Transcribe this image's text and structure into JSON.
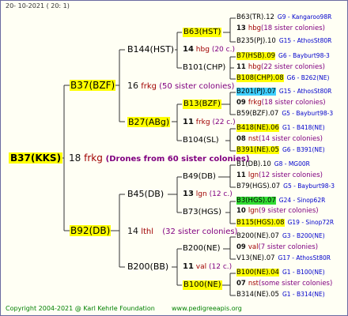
{
  "header": "20- 10-2021 ( 20: 1)",
  "footer": {
    "copyright": "Copyright 2004-2021 @ Karl Kehrle Foundation",
    "url": "www.pedigreeapis.org"
  },
  "root": {
    "name": "B37(KKS)",
    "num": "18",
    "code": "frkg",
    "note": "(Drones from 60 sister colonies)"
  },
  "gen1": [
    {
      "name": "B37(BZF)",
      "num": "16",
      "code": "frkg",
      "note": "(50 sister colonies)"
    },
    {
      "name": "B92(DB)",
      "num": "14",
      "code": "lthl",
      "note": "(32 sister colonies)"
    }
  ],
  "gen2": [
    {
      "name": "B144(HST)",
      "num": "14",
      "code": "hbg",
      "note": "(20 c.)"
    },
    {
      "name": "B27(ABg)",
      "num": "11",
      "code": "frkg",
      "note": "(22 c.)"
    },
    {
      "name": "B45(DB)",
      "num": "13",
      "code": "lgn",
      "note": "(12 c.)"
    },
    {
      "name": "B200(BB)",
      "num": "11",
      "code": "val",
      "note": "(12 c.)"
    }
  ],
  "gen3": [
    {
      "name": "B63(HST)",
      "num": "14",
      "code": "hbg",
      "note": "(20 c.)"
    },
    {
      "name": "B101(CHP)",
      "num": "11",
      "code": "hbg",
      "note": "(22 c.)"
    },
    {
      "name": "B13(BZF)",
      "num": "11",
      "code": "frkg",
      "note": "(22 c.)"
    },
    {
      "name": "B104(SL)",
      "num": "08",
      "code": "nst",
      "note": "(12 c.)"
    },
    {
      "name": "B49(DB)",
      "num": "11",
      "code": "lgn",
      "note": "(12 c.)"
    },
    {
      "name": "B73(HGS)",
      "num": "10",
      "code": "lgn",
      "note": "(12 c.)"
    },
    {
      "name": "B200(NE)",
      "num": "11",
      "code": "val",
      "note": "(12 c.)"
    },
    {
      "name": "B100(NE)",
      "num": "",
      "code": "",
      "note": ""
    }
  ],
  "gen4": [
    {
      "name": "B63(TR).12",
      "extra": "G9 - Kangaroo98R",
      "num": "13",
      "code": "hbg",
      "note": "(18 sister colonies)"
    },
    {
      "name": "B235(PJ).10",
      "extra": "G15 - AthosSt80R"
    },
    {
      "name": "B7(HSB).09",
      "extra": "G6 - Bayburt98-3",
      "num": "11",
      "code": "hbg",
      "note": "(22 sister colonies)"
    },
    {
      "name": "B108(CHP).08",
      "extra": "G6 - B262(NE)"
    },
    {
      "name": "B201(PJ).07",
      "extra": "G15 - AthosSt80R",
      "num": "09",
      "code": "frkg",
      "note": "(18 sister colonies)"
    },
    {
      "name": "B59(BZF).07",
      "extra": "G5 - Bayburt98-3"
    },
    {
      "name": "B418(NE).06",
      "extra": "G1 - B418(NE)",
      "num": "08",
      "code": "nst",
      "note": "(14 sister colonies)"
    },
    {
      "name": "B391(NE).05",
      "extra": "G6 - B391(NE)"
    },
    {
      "name": "B1(DB).10",
      "extra": "G8 - MG00R",
      "num": "11",
      "code": "lgn",
      "note": "(12 sister colonies)"
    },
    {
      "name": "B79(HGS).07",
      "extra": "G5 - Bayburt98-3"
    },
    {
      "name": "B3(HGS).07",
      "extra": "G24 - Sinop62R",
      "num": "10",
      "code": "lgn",
      "note": "(9 sister colonies)"
    },
    {
      "name": "B115(HGS).08",
      "extra": "G19 - Sinop72R"
    },
    {
      "name": "B200(NE).07",
      "extra": "G3 - B200(NE)",
      "num": "09",
      "code": "val",
      "note": "(7 sister colonies)"
    },
    {
      "name": "V13(NE).07",
      "extra": "G17 - AthosSt80R"
    },
    {
      "name": "B100(NE).04",
      "extra": "G1 - B100(NE)",
      "num": "07",
      "code": "nst",
      "note": "(some sister colonies)"
    },
    {
      "name": "B314(NE).05",
      "extra": "G1 - B314(NE)"
    }
  ]
}
